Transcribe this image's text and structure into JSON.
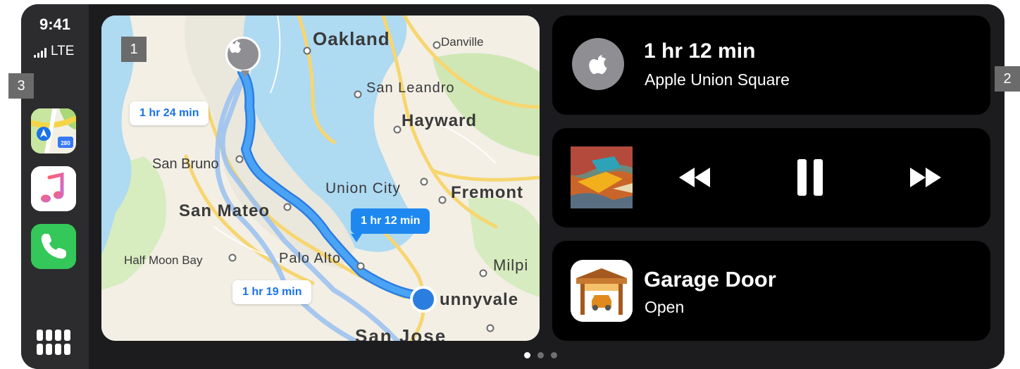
{
  "status": {
    "time": "9:41",
    "network": "LTE"
  },
  "dock": {
    "apps": [
      {
        "name": "Maps",
        "icon": "maps-app-icon"
      },
      {
        "name": "Music",
        "icon": "music-app-icon"
      },
      {
        "name": "Phone",
        "icon": "phone-app-icon"
      }
    ],
    "app_grid_icon": "app-grid-icon"
  },
  "map": {
    "city_labels": [
      "Oakland",
      "Danville",
      "San Leandro",
      "Hayward",
      "San Bruno",
      "Union City",
      "Fremont",
      "San Mateo",
      "Half Moon Bay",
      "Palo Alto",
      "Milpi",
      "unnyvale",
      "San Jose"
    ],
    "route_labels": {
      "primary": "1 hr 12 min",
      "alt1": "1 hr 24 min",
      "alt2": "1 hr 19 min"
    },
    "route_color": "#1e90ff"
  },
  "navigation": {
    "eta": "1 hr 12 min",
    "destination": "Apple Union Square",
    "icon": "apple-logo-icon"
  },
  "now_playing": {
    "controls": [
      "rewind-icon",
      "pause-icon",
      "fast-forward-icon"
    ]
  },
  "home": {
    "title": "Garage Door",
    "status": "Open",
    "icon": "garage-door-icon"
  },
  "page_dots": {
    "count": 3,
    "active": 1
  },
  "callouts": [
    "1",
    "2",
    "3"
  ]
}
